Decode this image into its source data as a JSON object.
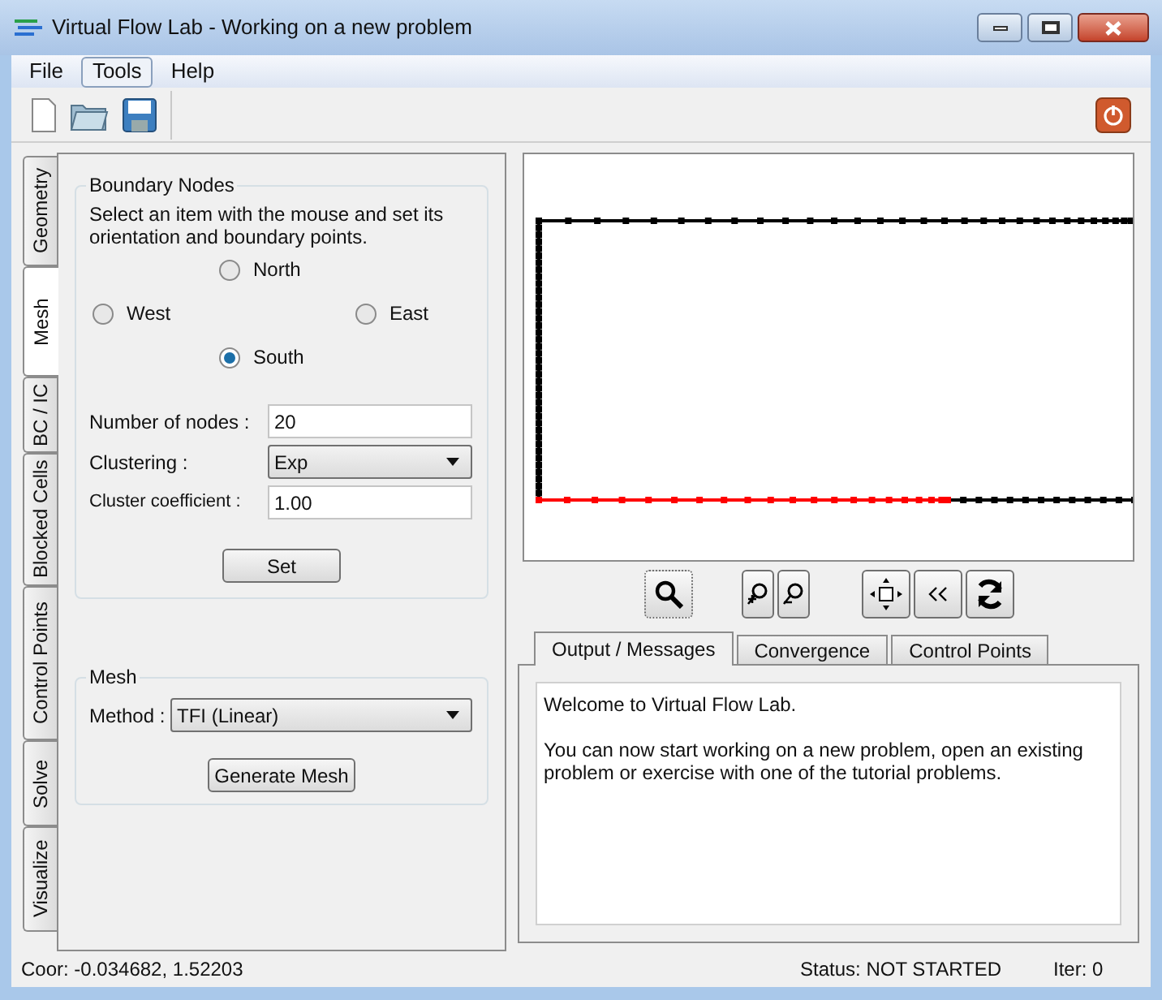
{
  "window": {
    "title": "Virtual Flow Lab - Working on a new problem"
  },
  "menu": [
    {
      "label": "File",
      "selected": false
    },
    {
      "label": "Tools",
      "selected": true
    },
    {
      "label": "Help",
      "selected": false
    }
  ],
  "side_tabs": [
    {
      "label": "Geometry",
      "selected": false
    },
    {
      "label": "Mesh",
      "selected": true
    },
    {
      "label": "BC / IC",
      "selected": false
    },
    {
      "label": "Blocked Cells",
      "selected": false
    },
    {
      "label": "Control Points",
      "selected": false
    },
    {
      "label": "Solve",
      "selected": false
    },
    {
      "label": "Visualize",
      "selected": false
    }
  ],
  "boundary_nodes": {
    "title": "Boundary Nodes",
    "instruction": "Select an item with the mouse and set its orientation and boundary points.",
    "north": {
      "label": "North",
      "selected": false
    },
    "west": {
      "label": "West",
      "selected": false
    },
    "east": {
      "label": "East",
      "selected": false
    },
    "south": {
      "label": "South",
      "selected": true
    },
    "number_of_nodes": {
      "label": "Number of nodes :",
      "value": "20"
    },
    "clustering": {
      "label": "Clustering :",
      "value": "Exp"
    },
    "cluster_coefficient": {
      "label": "Cluster coefficient :",
      "value": "1.00"
    },
    "set_button": "Set"
  },
  "mesh": {
    "title": "Mesh",
    "method": {
      "label": "Method :",
      "value": "TFI (Linear)"
    },
    "generate_button": "Generate Mesh"
  },
  "output_tabs": [
    {
      "label": "Output / Messages",
      "selected": true
    },
    {
      "label": "Convergence",
      "selected": false
    },
    {
      "label": "Control Points",
      "selected": false
    }
  ],
  "messages": [
    "Welcome to Virtual Flow Lab.",
    "You can now start working on a new problem, open an existing problem or exercise with one of the tutorial problems."
  ],
  "status_bar": {
    "coor": "Coor: -0.034682, 1.52203",
    "status": "Status: NOT STARTED",
    "iter": "Iter: 0"
  }
}
